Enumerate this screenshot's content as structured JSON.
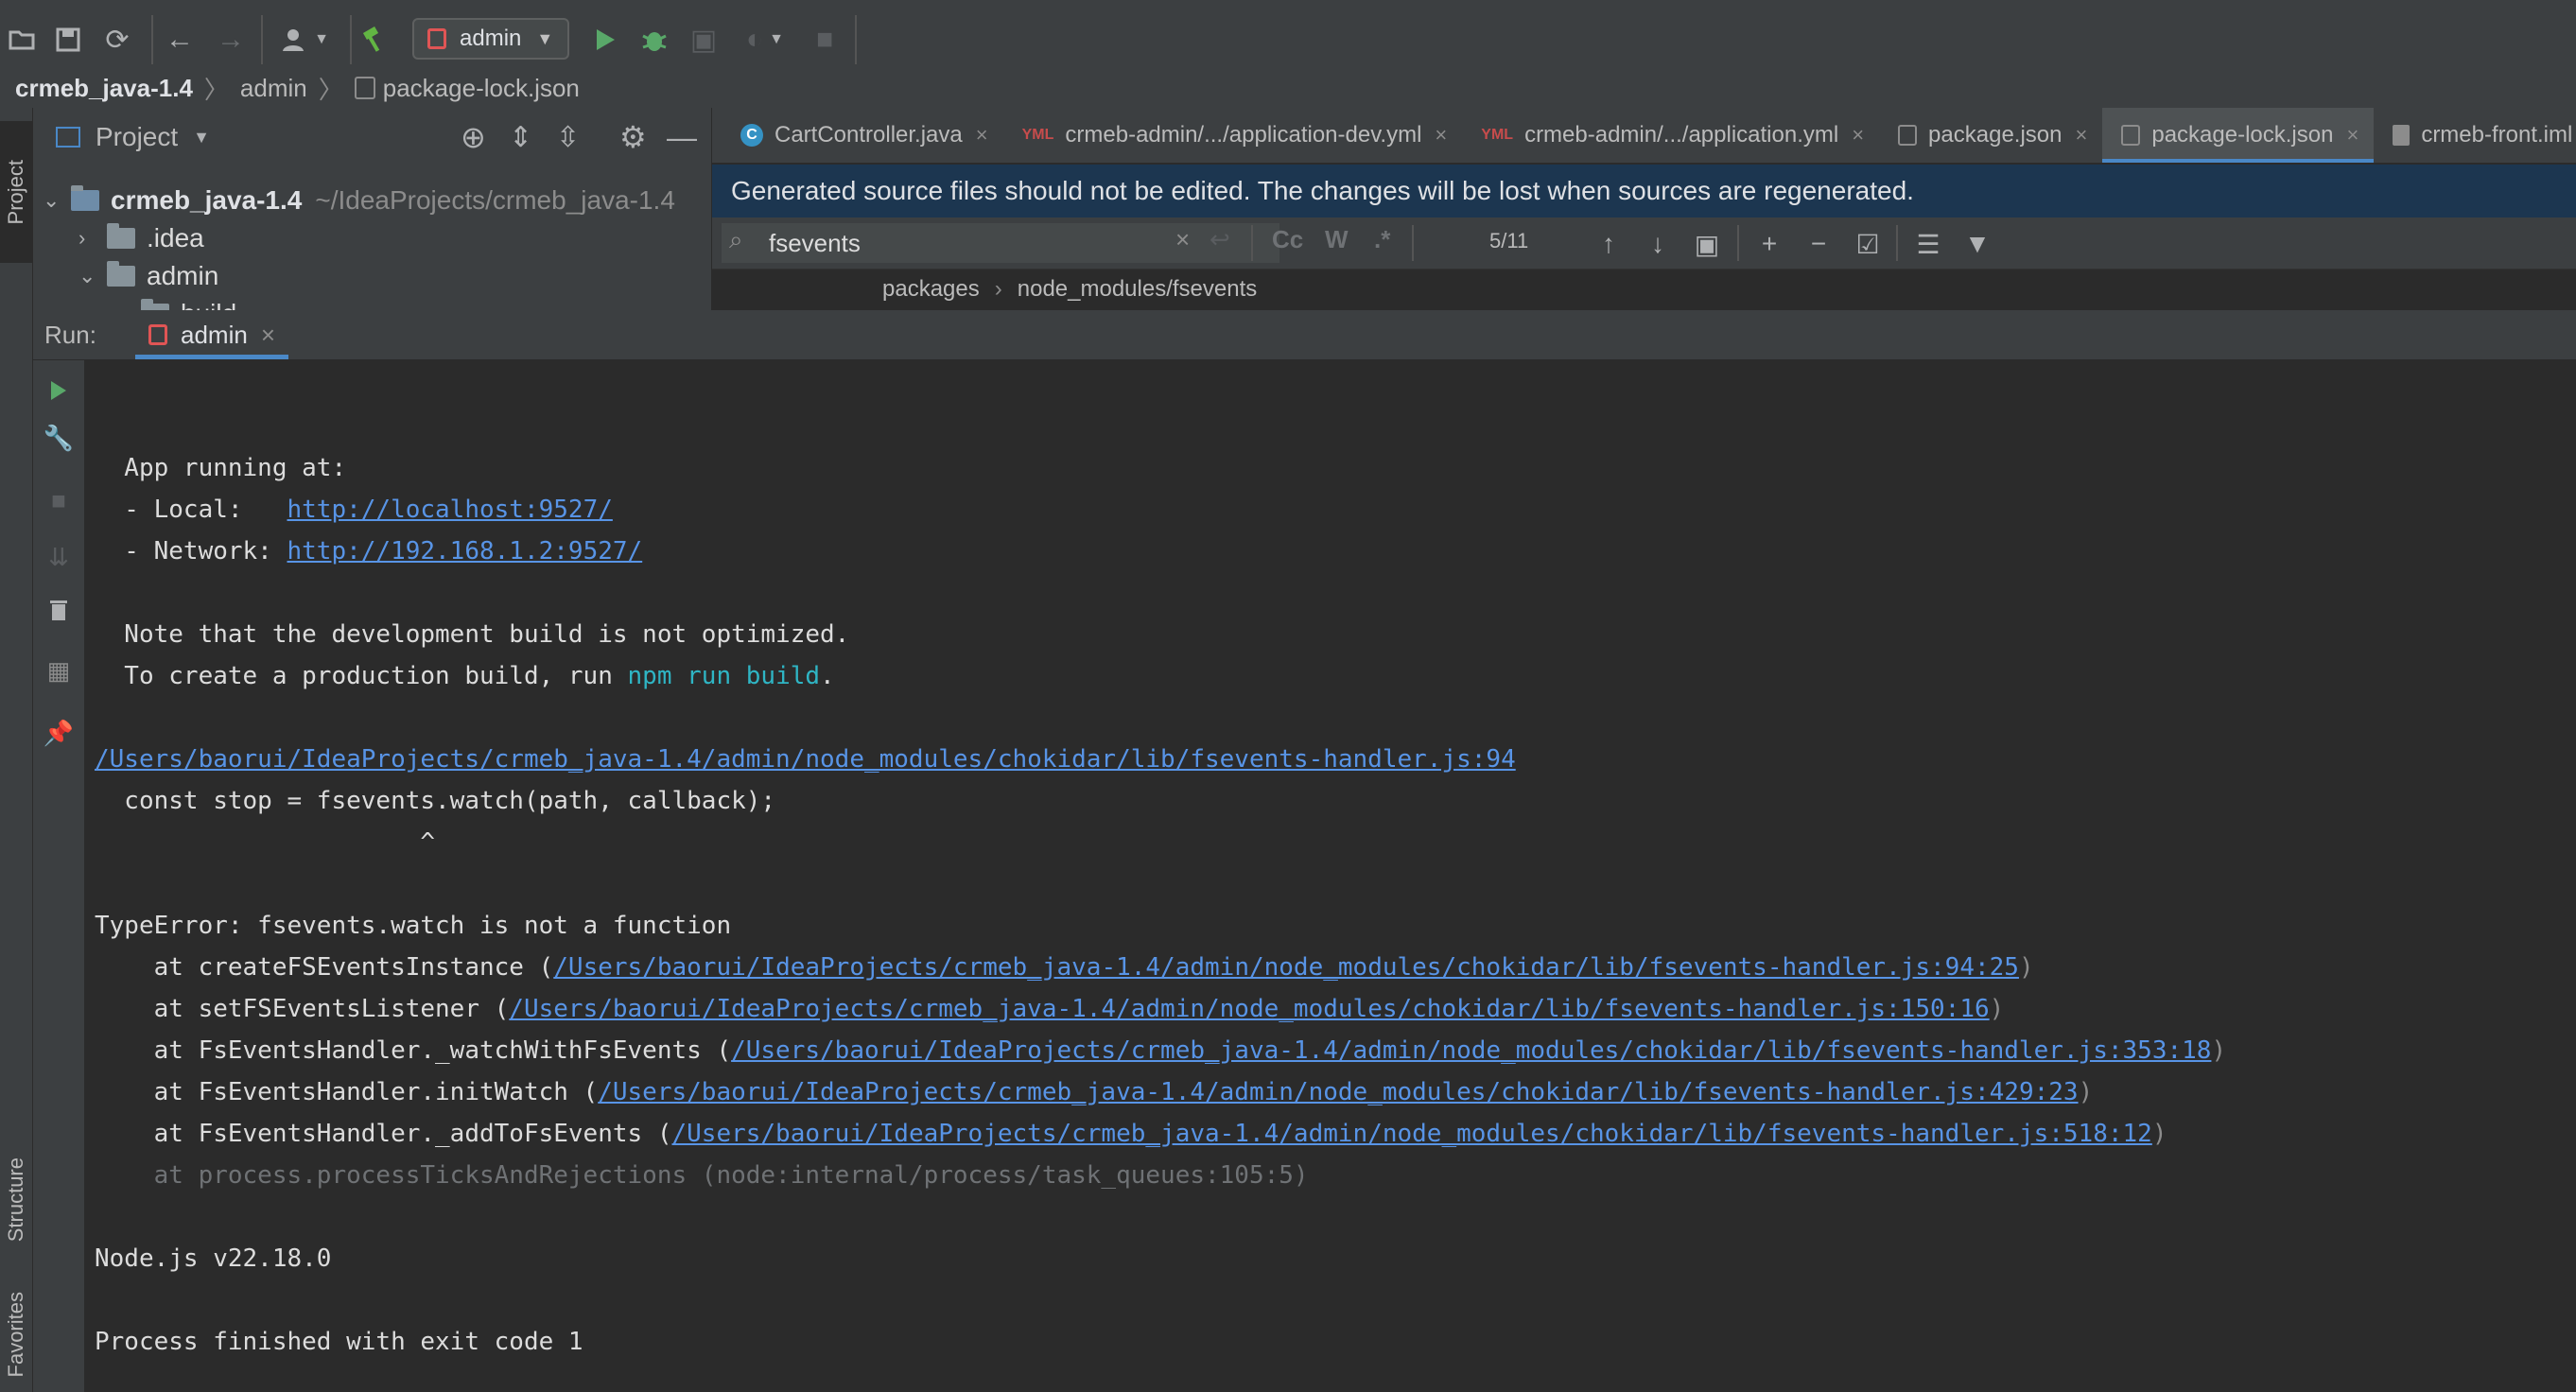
{
  "toolbar": {
    "run_config": "admin",
    "icons": [
      "open-icon",
      "save-icon",
      "sync-icon",
      "back-icon",
      "forward-icon",
      "user-icon",
      "build-hammer-icon",
      "run-icon",
      "debug-icon",
      "coverage-icon",
      "profile-icon",
      "stop-icon"
    ]
  },
  "breadcrumb": [
    "crmeb_java-1.4",
    "admin",
    "package-lock.json"
  ],
  "side_tabs": {
    "project": "Project",
    "structure": "Structure",
    "favorites": "Favorites"
  },
  "project_panel": {
    "title": "Project",
    "tree": [
      {
        "name": "crmeb_java-1.4",
        "path": "~/IdeaProjects/crmeb_java-1.4",
        "expanded": true
      },
      {
        "name": ".idea",
        "expanded": false
      },
      {
        "name": "admin",
        "expanded": true
      },
      {
        "name": "build",
        "expanded": false
      }
    ]
  },
  "editor_tabs": [
    {
      "label": "CartController.java",
      "icon": "java-class-icon",
      "active": false
    },
    {
      "label": "crmeb-admin/.../application-dev.yml",
      "icon": "yml-icon",
      "active": false
    },
    {
      "label": "crmeb-admin/.../application.yml",
      "icon": "yml-icon",
      "active": false
    },
    {
      "label": "package.json",
      "icon": "json-icon",
      "active": false
    },
    {
      "label": "package-lock.json",
      "icon": "json-icon",
      "active": true
    },
    {
      "label": "crmeb-front.iml",
      "icon": "iml-icon",
      "active": false
    }
  ],
  "banner": "Generated source files should not be edited. The changes will be lost when sources are regenerated.",
  "search": {
    "value": "fsevents",
    "result_count": "5/11",
    "options": [
      "Cc",
      "W",
      ".*"
    ]
  },
  "editor_breadcrumb": [
    "packages",
    "node_modules/fsevents"
  ],
  "run": {
    "label": "Run:",
    "tab": "admin",
    "console": {
      "app_running": "  App running at:",
      "local_label": "  - Local:   ",
      "local_url": "http://localhost:9527/",
      "network_label": "  - Network: ",
      "network_url": "http://192.168.1.2:9527/",
      "note": "  Note that the development build is not optimized.",
      "prod_prefix": "  To create a production build, run ",
      "prod_cmd": "npm run build",
      "prod_suffix": ".",
      "err_path": "/Users/baorui/IdeaProjects/crmeb_java-1.4/admin/node_modules/chokidar/lib/fsevents-handler.js:94",
      "code_line": "  const stop = fsevents.watch(path, callback);",
      "caret_line": "                      ^",
      "type_error": "TypeError: fsevents.watch is not a function",
      "stack": [
        {
          "prefix": "    at createFSEventsInstance (",
          "path": "/Users/baorui/IdeaProjects/crmeb_java-1.4/admin/node_modules/chokidar/lib/fsevents-handler.js:94:25",
          "suffix": ")"
        },
        {
          "prefix": "    at setFSEventsListener (",
          "path": "/Users/baorui/IdeaProjects/crmeb_java-1.4/admin/node_modules/chokidar/lib/fsevents-handler.js:150:16",
          "suffix": ")"
        },
        {
          "prefix": "    at FsEventsHandler._watchWithFsEvents (",
          "path": "/Users/baorui/IdeaProjects/crmeb_java-1.4/admin/node_modules/chokidar/lib/fsevents-handler.js:353:18",
          "suffix": ")"
        },
        {
          "prefix": "    at FsEventsHandler.initWatch (",
          "path": "/Users/baorui/IdeaProjects/crmeb_java-1.4/admin/node_modules/chokidar/lib/fsevents-handler.js:429:23",
          "suffix": ")"
        },
        {
          "prefix": "    at FsEventsHandler._addToFsEvents (",
          "path": "/Users/baorui/IdeaProjects/crmeb_java-1.4/admin/node_modules/chokidar/lib/fsevents-handler.js:518:12",
          "suffix": ")"
        }
      ],
      "internal": "    at process.processTicksAndRejections (node:internal/process/task_queues:105:5)",
      "node_version": "Node.js v22.18.0",
      "exit": "Process finished with exit code 1"
    }
  }
}
